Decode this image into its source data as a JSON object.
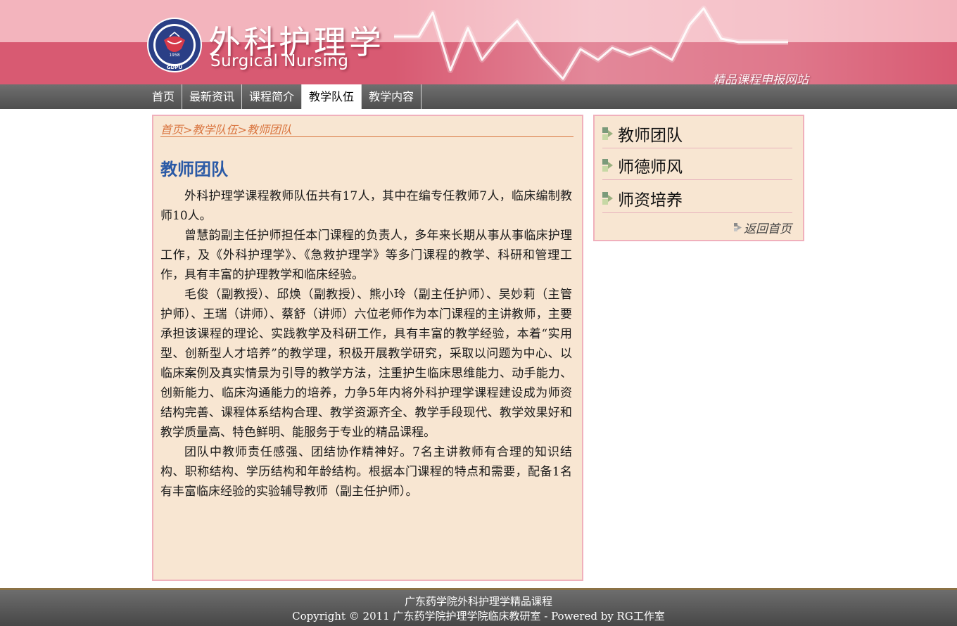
{
  "header": {
    "title_cn": "外科护理学",
    "title_en": "Surgical Nursing",
    "subtitle": "精品课程申报网站",
    "logo": {
      "badge_text": "GDPU",
      "year": "1958"
    }
  },
  "nav": {
    "items": [
      {
        "label": "首页",
        "active": false
      },
      {
        "label": "最新资讯",
        "active": false
      },
      {
        "label": "课程简介",
        "active": false
      },
      {
        "label": "教学队伍",
        "active": true
      },
      {
        "label": "教学内容",
        "active": false
      }
    ]
  },
  "breadcrumb": {
    "home": "首页",
    "sep1": ">",
    "section": "教学队伍",
    "sep2": ">",
    "current": "教师团队"
  },
  "main": {
    "title": "教师团队",
    "paragraphs": [
      "外科护理学课程教师队伍共有17人，其中在编专任教师7人，临床编制教师10人。",
      "曾慧韵副主任护师担任本门课程的负责人，多年来长期从事从事临床护理工作，及《外科护理学》、《急救护理学》等多门课程的教学、科研和管理工作，具有丰富的护理教学和临床经验。",
      "毛俊（副教授）、邱焕（副教授）、熊小玲（副主任护师）、吴妙莉（主管护师）、王瑞（讲师）、蔡舒（讲师）六位老师作为本门课程的主讲教师，主要承担该课程的理论、实践教学及科研工作，具有丰富的教学经验，本着“实用型、创新型人才培养”的教学理，积极开展教学研究，采取以问题为中心、以临床案例及真实情景为引导的教学方法，注重护生临床思维能力、动手能力、创新能力、临床沟通能力的培养，力争5年内将外科护理学课程建设成为师资结构完善、课程体系结构合理、教学资源齐全、教学手段现代、教学效果好和教学质量高、特色鲜明、能服务于专业的精品课程。",
      "团队中教师责任感强、团结协作精神好。7名主讲教师有合理的知识结构、职称结构、学历结构和年龄结构。根据本门课程的特点和需要，配备1名有丰富临床经验的实验辅导教师（副主任护师）。"
    ]
  },
  "side": {
    "items": [
      {
        "label": "教师团队"
      },
      {
        "label": "师德师风"
      },
      {
        "label": "师资培养"
      }
    ],
    "back_label": "返回首页"
  },
  "footer": {
    "line1": "广东药学院外科护理学精品课程",
    "line2": "Copyright © 2011 广东药学院护理学院临床教研室 - Powered by RG工作室"
  },
  "colors": {
    "header_pink": "#f3b4bd",
    "header_band": "#d85a72",
    "panel_bg": "#f8e6d2",
    "panel_border": "#f0b0bc",
    "title_blue": "#2b5aa6",
    "crumb_orange": "#d9743e"
  }
}
